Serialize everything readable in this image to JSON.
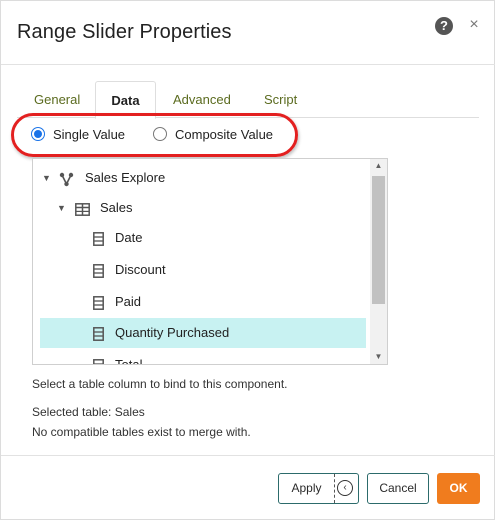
{
  "dialog": {
    "title": "Range Slider Properties",
    "help_icon": "?",
    "close_icon": "×"
  },
  "tabs": [
    {
      "label": "General",
      "active": false
    },
    {
      "label": "Data",
      "active": true
    },
    {
      "label": "Advanced",
      "active": false
    },
    {
      "label": "Script",
      "active": false
    }
  ],
  "value_mode": {
    "options": [
      {
        "label": "Single Value",
        "checked": true
      },
      {
        "label": "Composite Value",
        "checked": false
      }
    ]
  },
  "tree": {
    "items": [
      {
        "label": "Sales Explore",
        "icon": "data-model-icon",
        "expanded": true,
        "selected": false
      },
      {
        "label": "Sales",
        "icon": "table-icon",
        "expanded": true,
        "selected": false
      },
      {
        "label": "Date",
        "icon": "column-icon",
        "selected": false
      },
      {
        "label": "Discount",
        "icon": "column-icon",
        "selected": false
      },
      {
        "label": "Paid",
        "icon": "column-icon",
        "selected": false
      },
      {
        "label": "Quantity Purchased",
        "icon": "column-icon",
        "selected": true
      },
      {
        "label": "Total",
        "icon": "column-icon",
        "selected": false
      }
    ]
  },
  "hint_text": "Select a table column to bind to this component.",
  "selected_table_text": "Selected table: Sales",
  "merge_text": "No compatible tables exist to merge with.",
  "buttons": {
    "apply": "Apply",
    "cancel": "Cancel",
    "ok": "OK"
  },
  "colors": {
    "tab_inactive": "#5b6b1f",
    "radio_accent": "#1a73e8",
    "selection": "#c8f2f2",
    "ok_button": "#f07c1e",
    "annotation": "#e32020"
  }
}
